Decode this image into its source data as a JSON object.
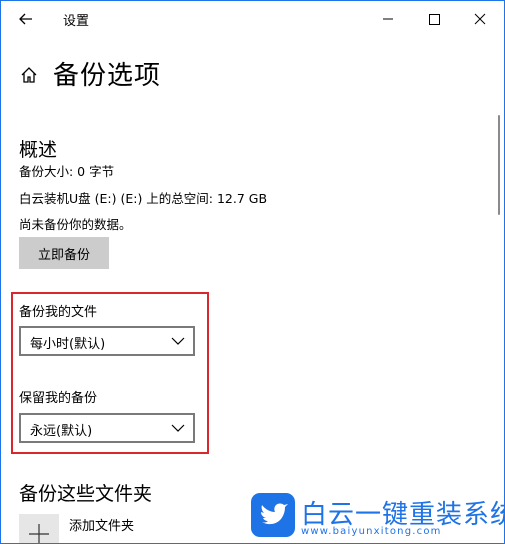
{
  "window": {
    "title": "设置"
  },
  "page": {
    "title": "备份选项"
  },
  "overview": {
    "heading": "概述",
    "backup_size": "备份大小: 0 字节",
    "total_space": "白云装机U盘 (E:) (E:) 上的总空间: 12.7 GB",
    "status": "尚未备份你的数据。",
    "backup_now": "立即备份"
  },
  "backup_files": {
    "label": "备份我的文件",
    "selected": "每小时(默认)"
  },
  "keep_backups": {
    "label": "保留我的备份",
    "selected": "永远(默认)"
  },
  "folders": {
    "heading": "备份这些文件夹",
    "add_label": "添加文件夹"
  },
  "watermark": {
    "text": "白云一键重装系统",
    "url": "www.baiyunxitong.com"
  },
  "colors": {
    "accent": "#1e73e6",
    "highlight_border": "#d9272e",
    "button_bg": "#cccccc"
  },
  "icons": [
    "back-arrow-icon",
    "minimize-icon",
    "maximize-icon",
    "close-icon",
    "home-icon",
    "chevron-down-icon",
    "plus-icon",
    "bird-logo-icon"
  ]
}
